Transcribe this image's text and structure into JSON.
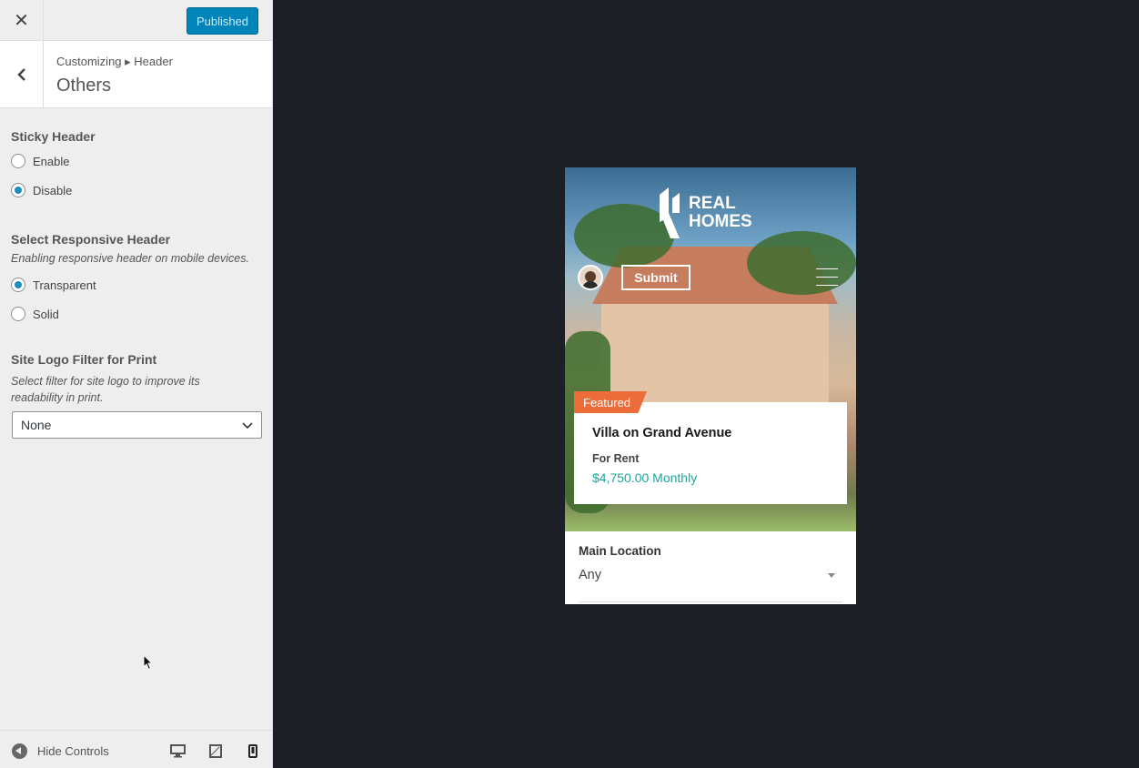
{
  "topbar": {
    "close_label": "✕",
    "publish_label": "Published"
  },
  "section": {
    "breadcrumb": "Customizing ▸ Header",
    "title": "Others"
  },
  "sticky_header": {
    "title": "Sticky Header",
    "options": [
      {
        "label": "Enable",
        "checked": false
      },
      {
        "label": "Disable",
        "checked": true
      }
    ]
  },
  "responsive_header": {
    "title": "Select Responsive Header",
    "description": "Enabling responsive header on mobile devices.",
    "options": [
      {
        "label": "Transparent",
        "checked": true
      },
      {
        "label": "Solid",
        "checked": false
      }
    ]
  },
  "logo_filter": {
    "title": "Site Logo Filter for Print",
    "description": "Select filter for site logo to improve its readability in print.",
    "selected": "None"
  },
  "footer": {
    "hide_controls_label": "Hide Controls"
  },
  "preview": {
    "logo_line1": "REAL",
    "logo_line2": "HOMES",
    "submit_label": "Submit",
    "featured_badge": "Featured",
    "property_title": "Villa on Grand Avenue",
    "property_status": "For Rent",
    "property_price": "$4,750.00 Monthly",
    "search_label": "Main Location",
    "search_value": "Any"
  },
  "colors": {
    "accent": "#0085ba",
    "badge": "#ec6c3a",
    "price": "#1ea69a",
    "preview_bg": "#1d1f27"
  }
}
